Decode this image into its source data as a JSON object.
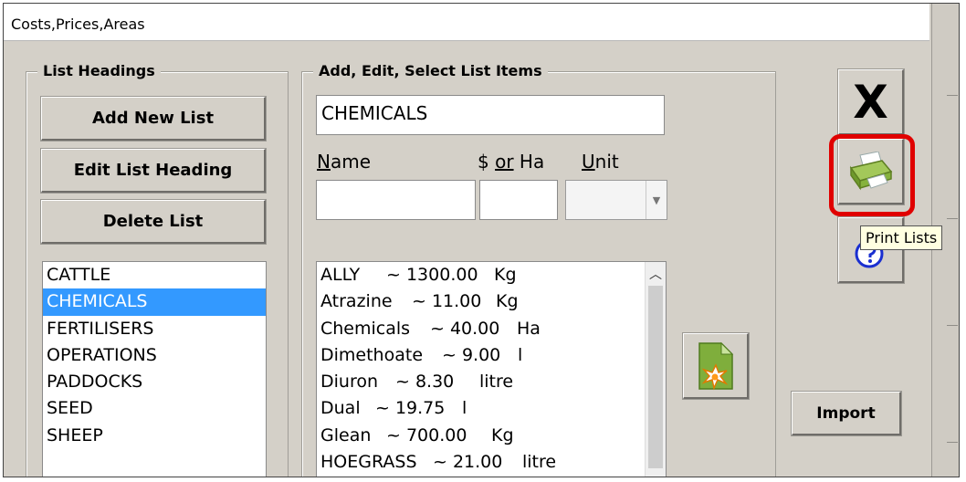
{
  "window": {
    "title": "Costs,Prices,Areas"
  },
  "list_headings": {
    "label": "List Headings",
    "add_new_list": "Add New List",
    "edit_list_heading": "Edit List Heading",
    "delete_list": "Delete List",
    "items": [
      "CATTLE",
      "CHEMICALS",
      "FERTILISERS",
      "OPERATIONS",
      "PADDOCKS",
      "SEED",
      "SHEEP"
    ],
    "selected": "CHEMICALS"
  },
  "list_items": {
    "label": "Add, Edit, Select List Items",
    "heading_value": "CHEMICALS",
    "name_label_first": "N",
    "name_label_rest": "ame",
    "price_label_pre": "$ ",
    "price_label_u": "or",
    "price_label_post": " Ha",
    "unit_label_first": "U",
    "unit_label_rest": "nit",
    "name_value": "",
    "price_value": "",
    "unit_value": "",
    "items": [
      {
        "name": "ALLY",
        "price": "~ 1300.00",
        "unit": "Kg"
      },
      {
        "name": "Atrazine",
        "price": "~ 11.00",
        "unit": "Kg"
      },
      {
        "name": "Chemicals",
        "price": "~ 40.00",
        "unit": "Ha"
      },
      {
        "name": "Dimethoate",
        "price": "~ 9.00",
        "unit": "l"
      },
      {
        "name": "Diuron",
        "price": "~ 8.30",
        "unit": "litre"
      },
      {
        "name": "Dual",
        "price": "~ 19.75",
        "unit": "l"
      },
      {
        "name": "Glean",
        "price": "~ 700.00",
        "unit": "Kg"
      },
      {
        "name": "HOEGRASS",
        "price": "~ 21.00",
        "unit": "litre"
      }
    ]
  },
  "toolbar": {
    "close_glyph": "X",
    "tooltip": "Print Lists",
    "import_label": "Import",
    "icons": [
      "close-icon",
      "printer-icon",
      "help-icon",
      "new-document-icon"
    ]
  },
  "colors": {
    "selection": "#3399ff",
    "highlight": "#e00000",
    "printer": "#8ab63e",
    "help": "#1a2fd0"
  }
}
